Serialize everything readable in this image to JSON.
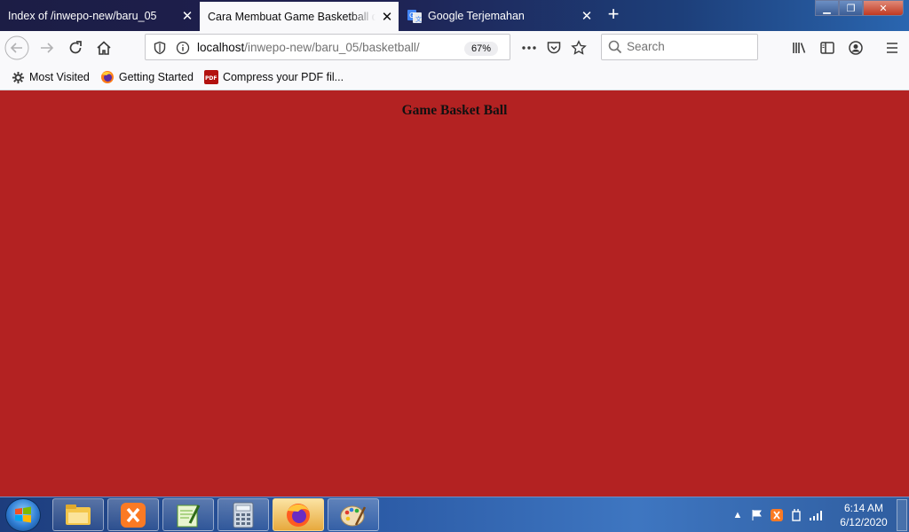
{
  "tabs": [
    {
      "title": "Index of /inwepo-new/baru_05",
      "active": false
    },
    {
      "title": "Cara Membuat Game Basketball dengan JavaScript",
      "active": true
    },
    {
      "title": "Google Terjemahan",
      "active": false,
      "icon": "google-translate-icon"
    }
  ],
  "navbar": {
    "url_host": "localhost",
    "url_path": "/inwepo-new/baru_05/basketball/",
    "zoom": "67%",
    "search_placeholder": "Search"
  },
  "bookmarks": [
    {
      "label": "Most Visited",
      "icon": "gear-icon"
    },
    {
      "label": "Getting Started",
      "icon": "firefox-icon"
    },
    {
      "label": "Compress your PDF fil...",
      "icon": "pdf-icon"
    }
  ],
  "page": {
    "heading": "Game Basket Ball",
    "background": "#b32222"
  },
  "taskbar": {
    "time": "6:14 AM",
    "date": "6/12/2020",
    "apps": [
      "file-explorer-icon",
      "xampp-icon",
      "notepad-plus-plus-icon",
      "calculator-icon",
      "firefox-icon",
      "paint-icon"
    ]
  }
}
